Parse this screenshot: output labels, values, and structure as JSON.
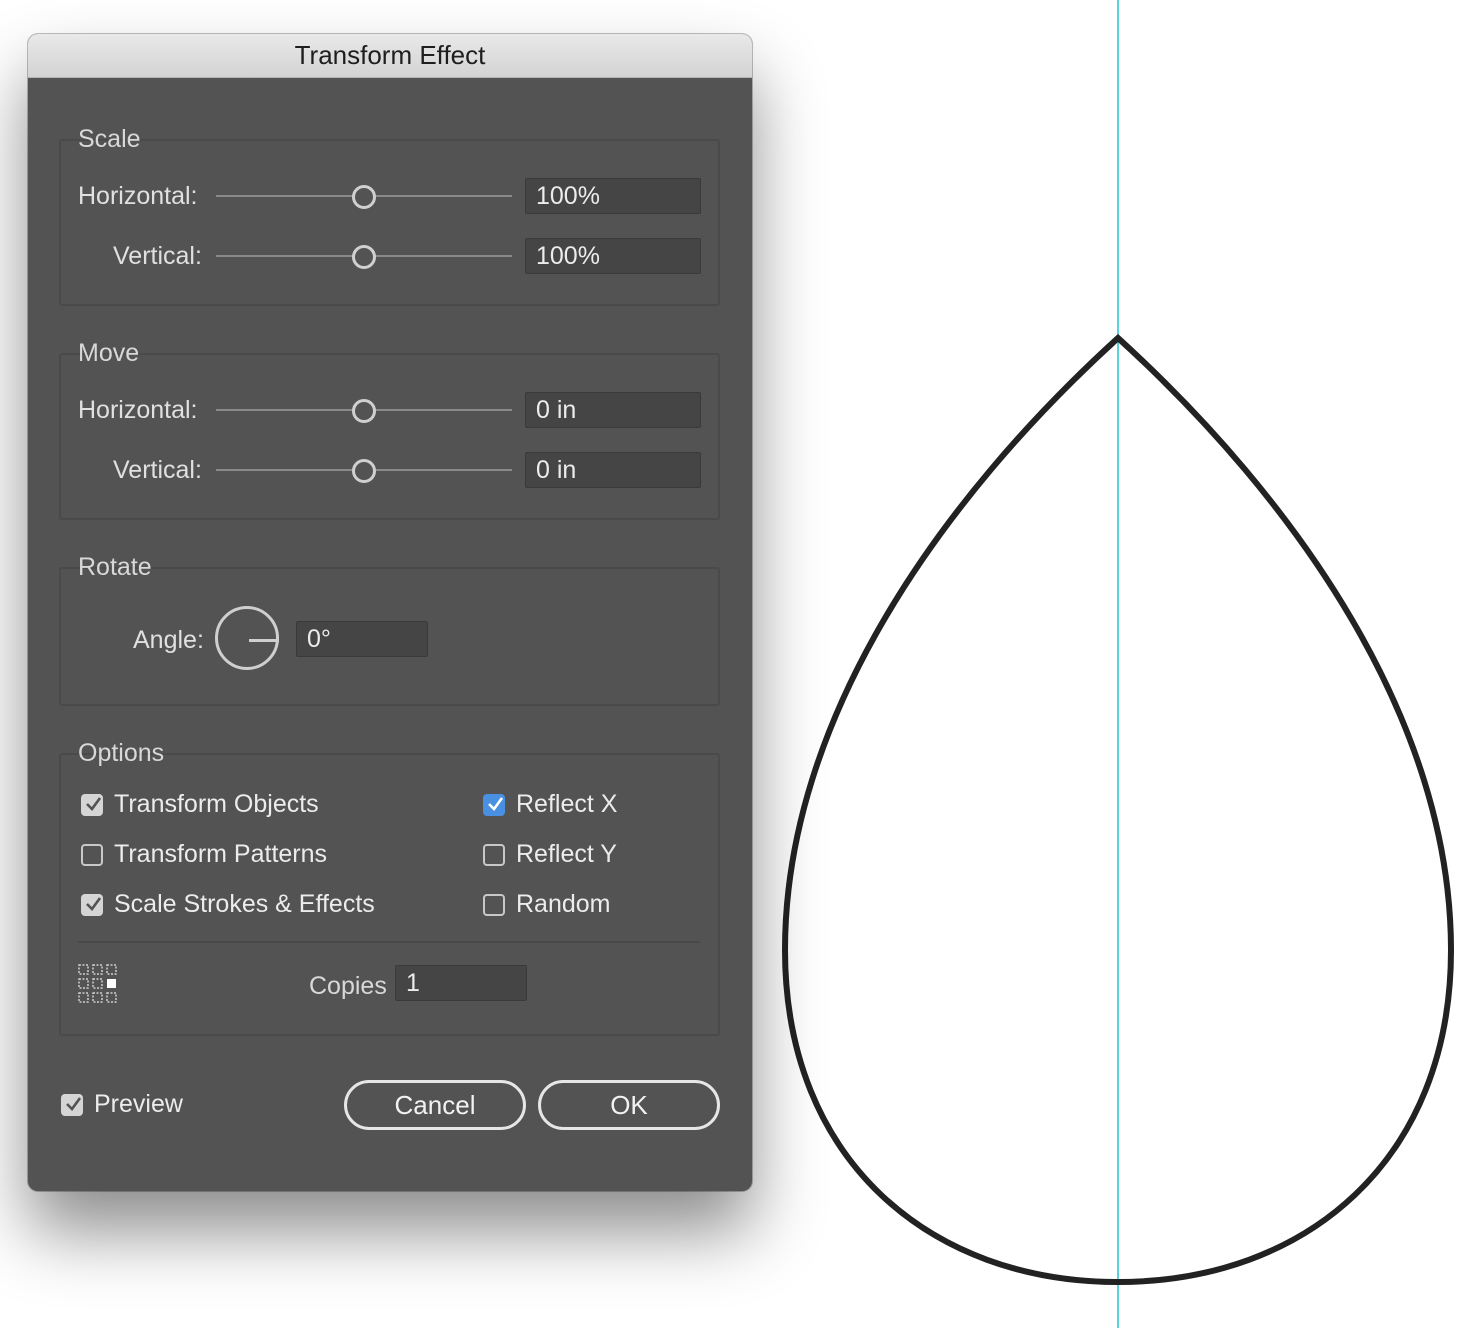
{
  "dialog": {
    "title": "Transform Effect",
    "scale": {
      "label": "Scale",
      "horizontal_label": "Horizontal:",
      "horizontal_value": "100%",
      "vertical_label": "Vertical:",
      "vertical_value": "100%"
    },
    "move": {
      "label": "Move",
      "horizontal_label": "Horizontal:",
      "horizontal_value": "0 in",
      "vertical_label": "Vertical:",
      "vertical_value": "0 in"
    },
    "rotate": {
      "label": "Rotate",
      "angle_label": "Angle:",
      "angle_value": "0°"
    },
    "options": {
      "label": "Options",
      "transform_objects": "Transform Objects",
      "transform_patterns": "Transform Patterns",
      "scale_strokes_effects": "Scale Strokes & Effects",
      "reflect_x": "Reflect X",
      "reflect_y": "Reflect Y",
      "random": "Random",
      "copies_label": "Copies",
      "copies_value": "1"
    },
    "preview_label": "Preview",
    "cancel_label": "Cancel",
    "ok_label": "OK"
  },
  "checks": {
    "transform_objects": true,
    "transform_patterns": false,
    "scale_strokes_effects": true,
    "reflect_x": true,
    "reflect_y": false,
    "random": false,
    "preview": true
  },
  "colors": {
    "dialog_bg": "#535353",
    "guide": "#5ad2dc",
    "accent": "#4a90e2"
  }
}
